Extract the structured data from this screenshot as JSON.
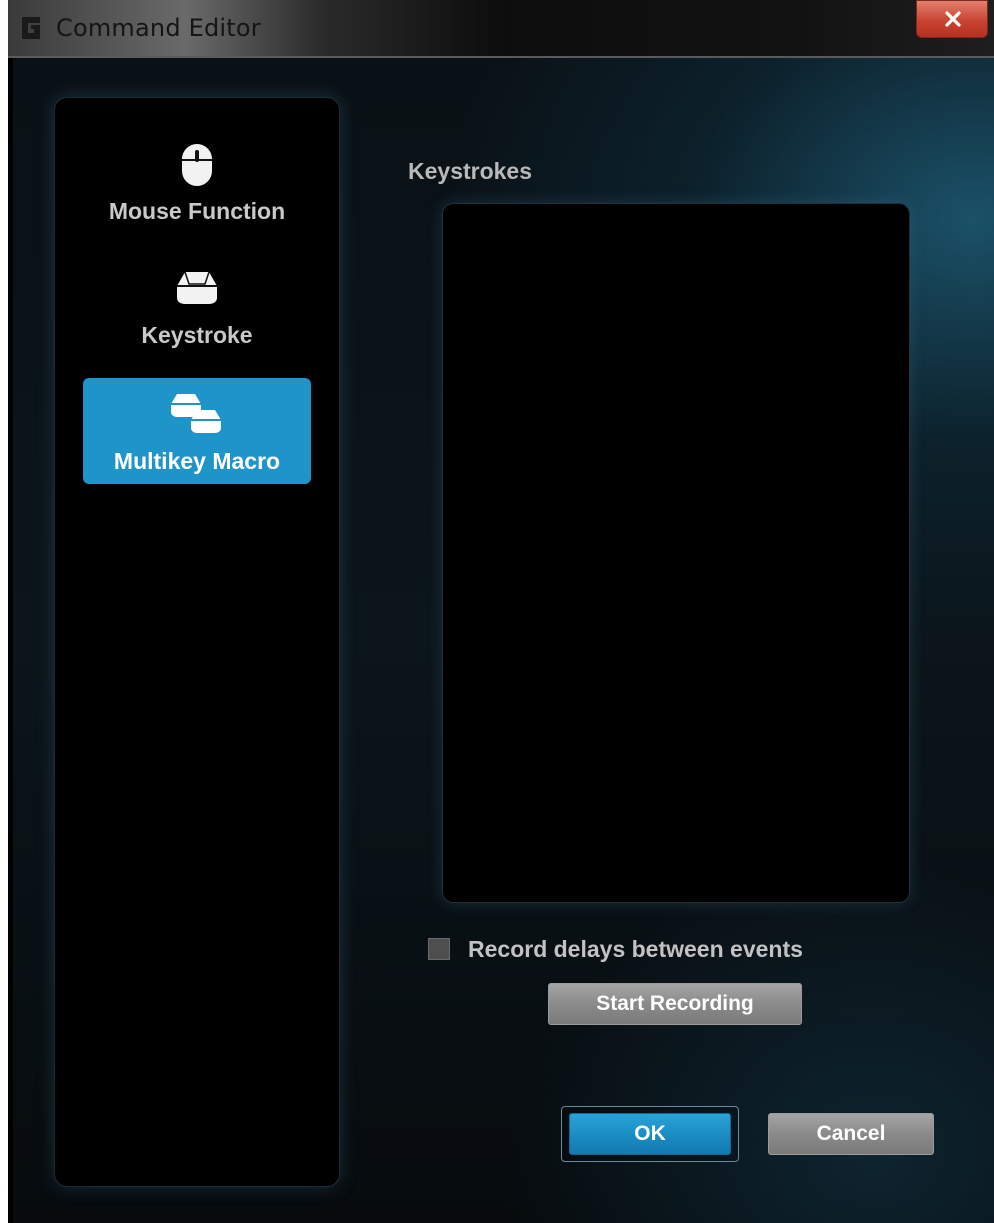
{
  "window": {
    "title": "Command Editor"
  },
  "sidebar": {
    "items": [
      {
        "label": "Mouse Function",
        "icon": "mouse-icon",
        "active": false
      },
      {
        "label": "Keystroke",
        "icon": "key-icon",
        "active": false
      },
      {
        "label": "Multikey Macro",
        "icon": "multikey-icon",
        "active": true
      }
    ]
  },
  "main": {
    "keystrokes_label": "Keystrokes",
    "record_delays": {
      "label": "Record delays between events",
      "checked": false
    },
    "start_recording_label": "Start Recording"
  },
  "footer": {
    "ok_label": "OK",
    "cancel_label": "Cancel"
  },
  "colors": {
    "accent": "#1f94c8",
    "close_button": "#c84432"
  }
}
